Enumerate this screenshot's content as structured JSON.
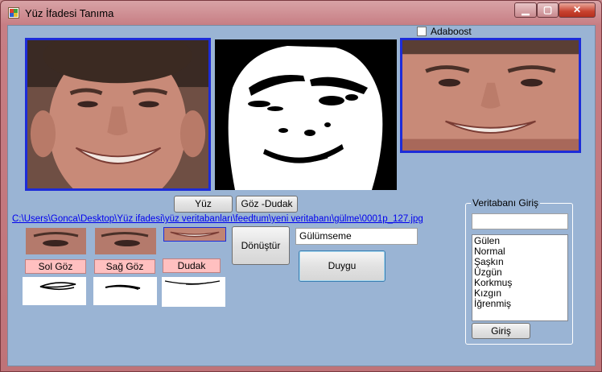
{
  "window": {
    "title": "Yüz İfadesi Tanıma",
    "controls": {
      "minimize": "▁",
      "maximize": "▢",
      "close": "✕"
    }
  },
  "adaboost": {
    "label": "Adaboost",
    "checked": false
  },
  "buttons": {
    "yuz": "Yüz",
    "goz_dudak": "Göz -Dudak",
    "donustur": "Dönüştür",
    "duygu": "Duygu",
    "giris": "Giriş"
  },
  "file_path": "C:\\Users\\Gonca\\Desktop\\Yüz ifadesi\\yüz veritabanları\\feedtum\\yeni veritabanı\\gülme\\0001p_127.jpg",
  "feature_labels": {
    "sol_goz": "Sol Göz",
    "sag_goz": "Sağ Göz",
    "dudak": "Dudak"
  },
  "result_text": "Gülümseme",
  "database_group": {
    "title": "Veritabanı Giriş",
    "input_value": "",
    "expressions": [
      "Gülen",
      "Normal",
      "Şaşkın",
      "Üzgün",
      "Korkmuş",
      "Kızgın",
      "İğrenmiş"
    ]
  },
  "icons": {
    "app": "app-icon",
    "checkbox": "checkbox-icon"
  },
  "colors": {
    "photo_border": "#1d2cd8",
    "client_bg": "#9ab4d4",
    "feature_label_bg": "#ffc0c0",
    "link": "#0000ee"
  }
}
